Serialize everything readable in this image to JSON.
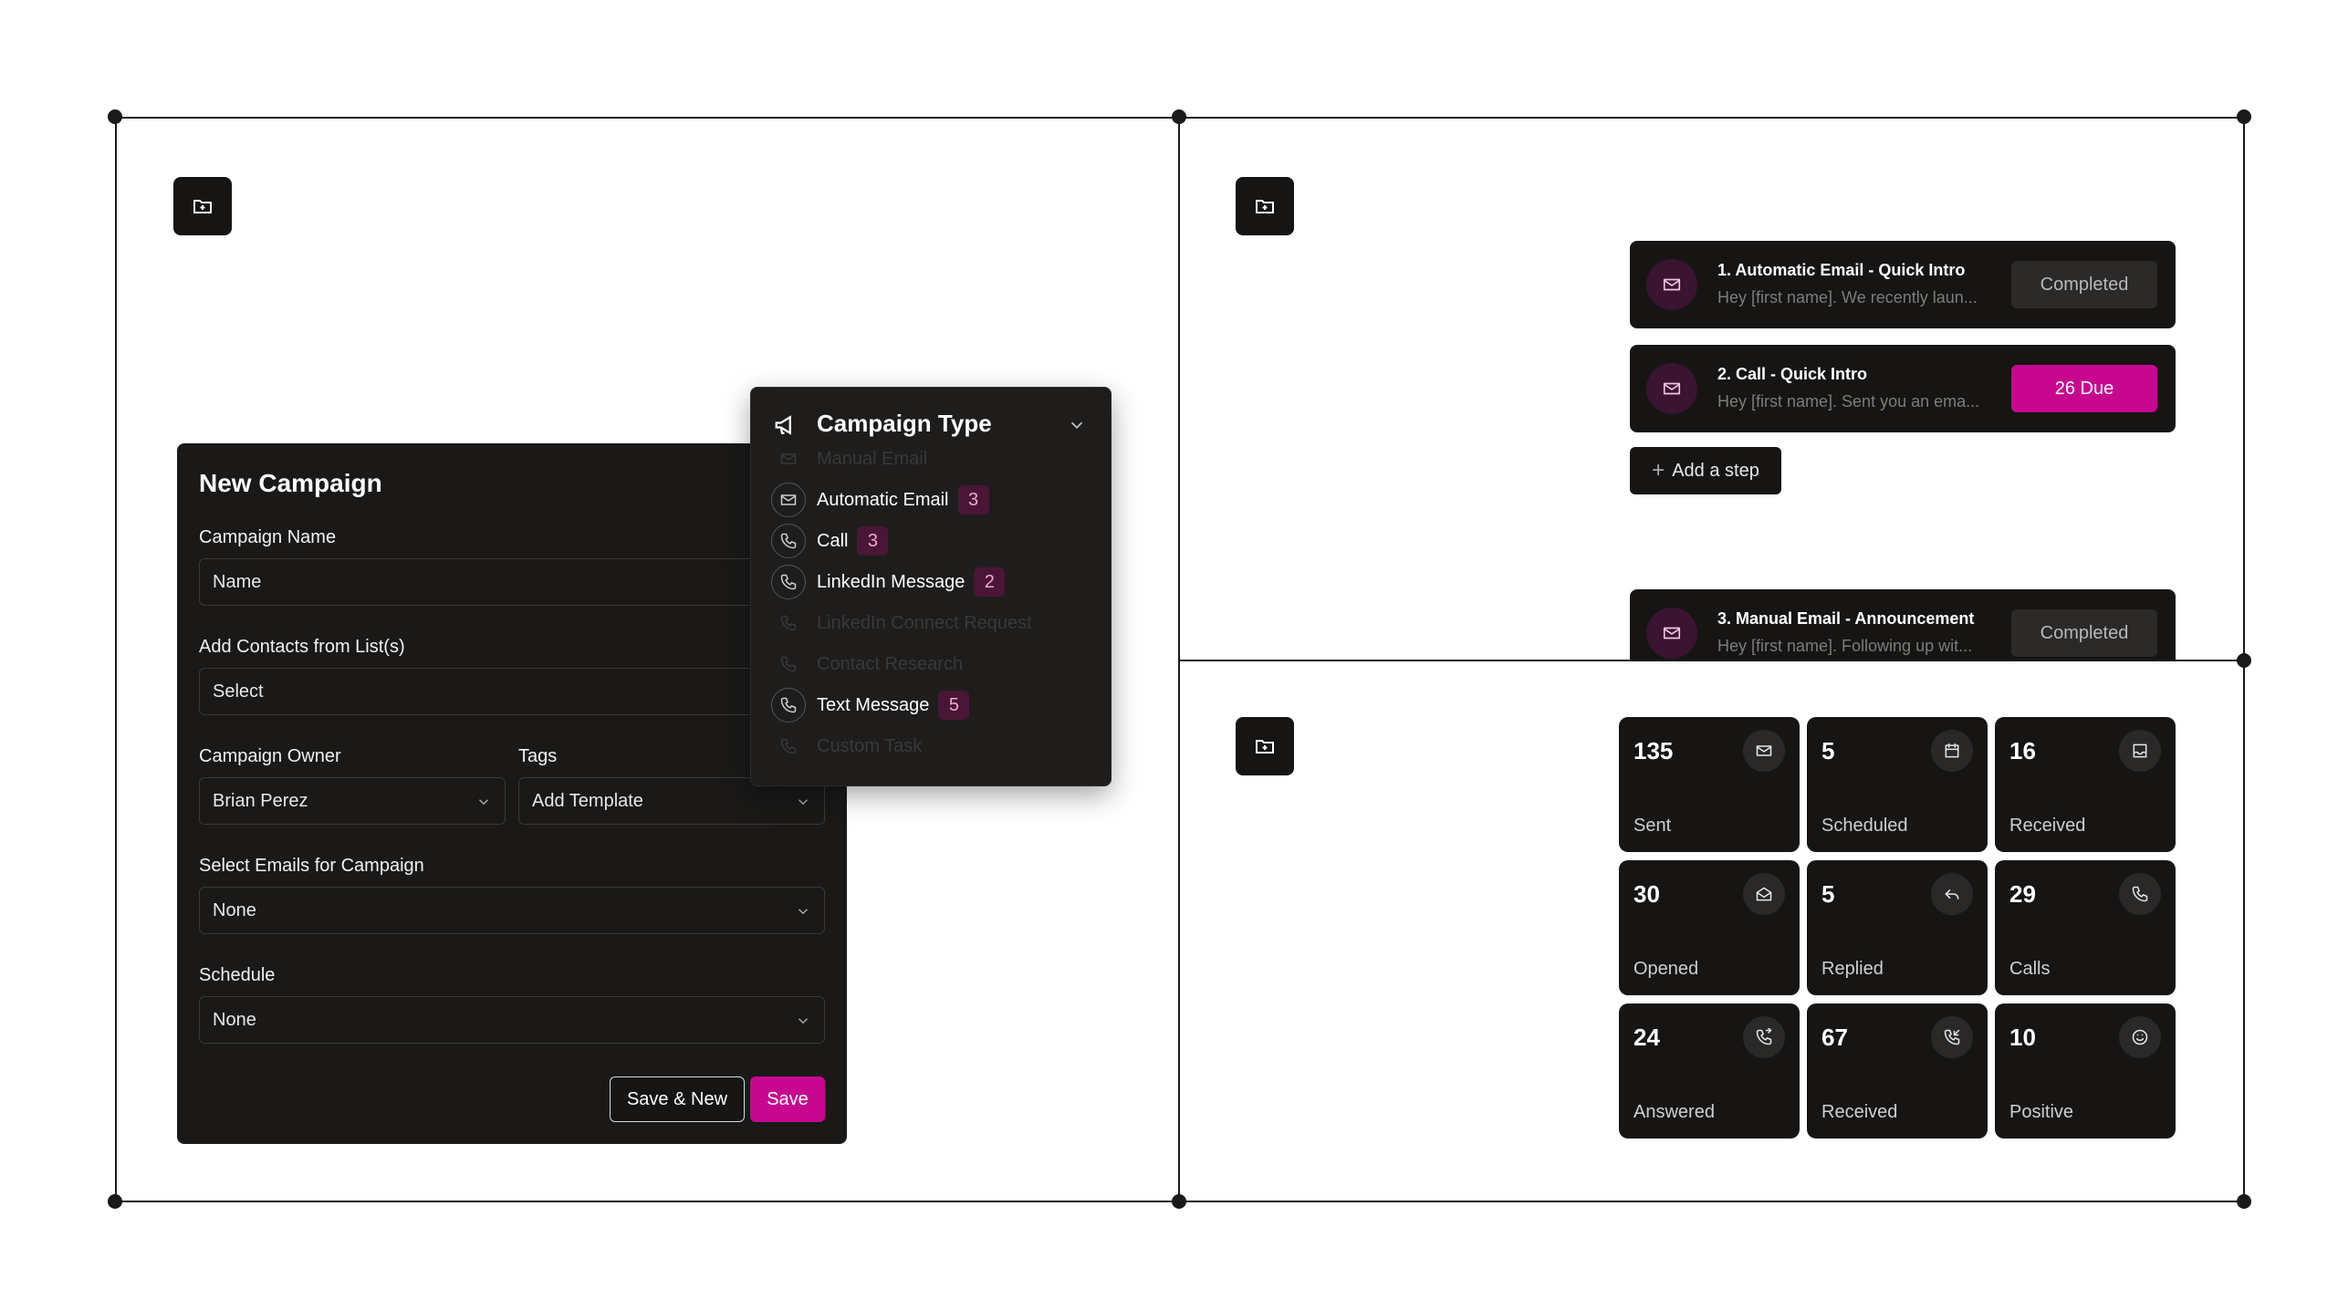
{
  "colors": {
    "accent": "#c7088f",
    "panel": "#161514",
    "badge_bg": "#4a1636"
  },
  "new_campaign": {
    "title": "New Campaign",
    "campaign_name_label": "Campaign Name",
    "campaign_name_placeholder": "Name",
    "contacts_label": "Add Contacts from List(s)",
    "contacts_value": "Select",
    "owner_label": "Campaign Owner",
    "owner_value": "Brian Perez",
    "tags_label": "Tags",
    "tags_value": "Add Template",
    "emails_label": "Select Emails for Campaign",
    "emails_value": "None",
    "schedule_label": "Schedule",
    "schedule_value": "None",
    "save_new_label": "Save & New",
    "save_label": "Save"
  },
  "campaign_type": {
    "title": "Campaign Type",
    "items": [
      {
        "label": "Manual Email",
        "count": "",
        "icon": "mail-icon",
        "disabled": true
      },
      {
        "label": "Automatic Email",
        "count": "3",
        "icon": "mail-icon",
        "disabled": false
      },
      {
        "label": "Call",
        "count": "3",
        "icon": "phone-icon",
        "disabled": false
      },
      {
        "label": "LinkedIn Message",
        "count": "2",
        "icon": "phone-icon",
        "disabled": false
      },
      {
        "label": "LinkedIn Connect Request",
        "count": "",
        "icon": "phone-icon",
        "disabled": true
      },
      {
        "label": "Contact Research",
        "count": "",
        "icon": "phone-icon",
        "disabled": true
      },
      {
        "label": "Text Message",
        "count": "5",
        "icon": "phone-icon",
        "disabled": false
      },
      {
        "label": "Custom Task",
        "count": "",
        "icon": "phone-icon",
        "disabled": true
      }
    ]
  },
  "sequence": {
    "steps": [
      {
        "title": "1. Automatic Email - Quick Intro",
        "preview": "Hey [first name]. We recently laun...",
        "status": "Completed"
      },
      {
        "title": "2. Call - Quick Intro",
        "preview": "Hey [first name]. Sent you an ema...",
        "status": "26 Due"
      },
      {
        "title": "3. Manual Email - Announcement",
        "preview": "Hey [first name]. Following up wit...",
        "status": "Completed"
      }
    ],
    "add_step_label": "Add a step"
  },
  "stats": [
    {
      "value": "135",
      "label": "Sent",
      "icon": "mail-icon"
    },
    {
      "value": "5",
      "label": "Scheduled",
      "icon": "calendar-icon"
    },
    {
      "value": "16",
      "label": "Received",
      "icon": "inbox-icon"
    },
    {
      "value": "30",
      "label": "Opened",
      "icon": "mail-open-icon"
    },
    {
      "value": "5",
      "label": "Replied",
      "icon": "reply-icon"
    },
    {
      "value": "29",
      "label": "Calls",
      "icon": "phone-icon"
    },
    {
      "value": "24",
      "label": "Answered",
      "icon": "phone-forwarded-icon"
    },
    {
      "value": "67",
      "label": "Received",
      "icon": "phone-incoming-icon"
    },
    {
      "value": "10",
      "label": "Positive",
      "icon": "smile-icon"
    }
  ]
}
